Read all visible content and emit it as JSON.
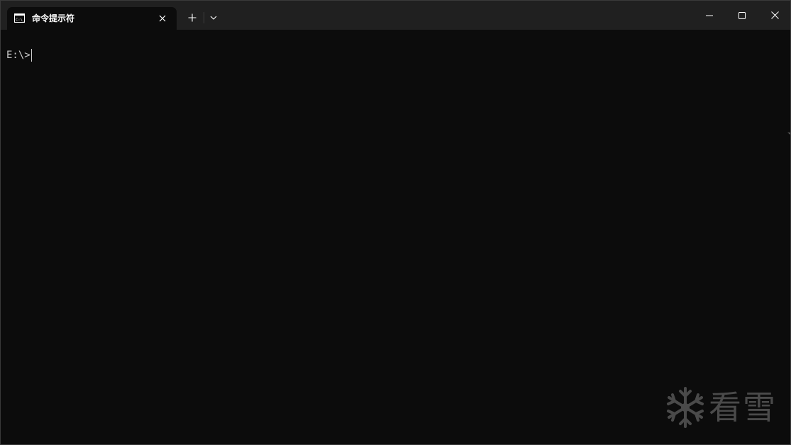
{
  "tabs": [
    {
      "title": "命令提示符",
      "icon": "cmd-icon",
      "active": true
    }
  ],
  "titlebar": {
    "new_tab_icon": "plus-icon",
    "dropdown_icon": "chevron-down-icon",
    "minimize_icon": "minimize-icon",
    "maximize_icon": "maximize-icon",
    "close_icon": "close-icon"
  },
  "console": {
    "prompt": "E:\\>"
  },
  "watermark": {
    "text": "看雪",
    "icon": "snowflake-icon"
  },
  "colors": {
    "titlebar_bg": "#202020",
    "console_bg": "#0c0c0c",
    "text": "#cccccc",
    "watermark": "#4a4a4a"
  }
}
